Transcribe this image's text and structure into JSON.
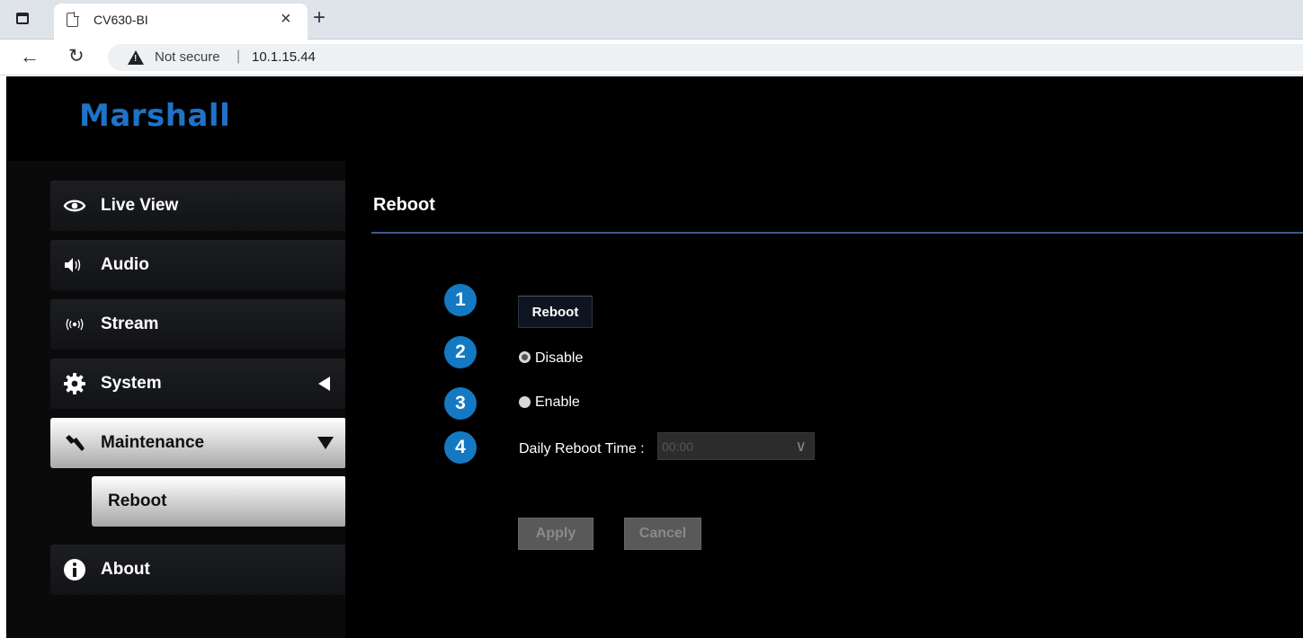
{
  "browser": {
    "tab_title": "CV630-BI",
    "tab_close": "×",
    "new_tab": "+",
    "security_label": "Not secure",
    "url": "10.1.15.44"
  },
  "header": {
    "logo_text": "Marshall",
    "brand_color": "#1e73c8"
  },
  "sidebar": {
    "items": [
      {
        "label": "Live View",
        "icon": "eye-icon"
      },
      {
        "label": "Audio",
        "icon": "speaker-icon"
      },
      {
        "label": "Stream",
        "icon": "broadcast-icon"
      },
      {
        "label": "System",
        "icon": "gear-icon",
        "indicator": "collapsed"
      },
      {
        "label": "Maintenance",
        "icon": "wrench-icon",
        "indicator": "expanded",
        "active": true
      },
      {
        "label": "About",
        "icon": "info-icon"
      }
    ],
    "subitems": [
      {
        "label": "Reboot",
        "active": true
      }
    ]
  },
  "main": {
    "title": "Reboot",
    "badges": [
      "1",
      "2",
      "3",
      "4"
    ],
    "badge_color": "#1479c2",
    "reboot_button": "Reboot",
    "schedule_options": [
      {
        "label": "Disable",
        "checked": true
      },
      {
        "label": "Enable",
        "checked": false
      }
    ],
    "time_label": "Daily Reboot Time :",
    "time_value": "00:00",
    "apply_label": "Apply",
    "cancel_label": "Cancel"
  }
}
